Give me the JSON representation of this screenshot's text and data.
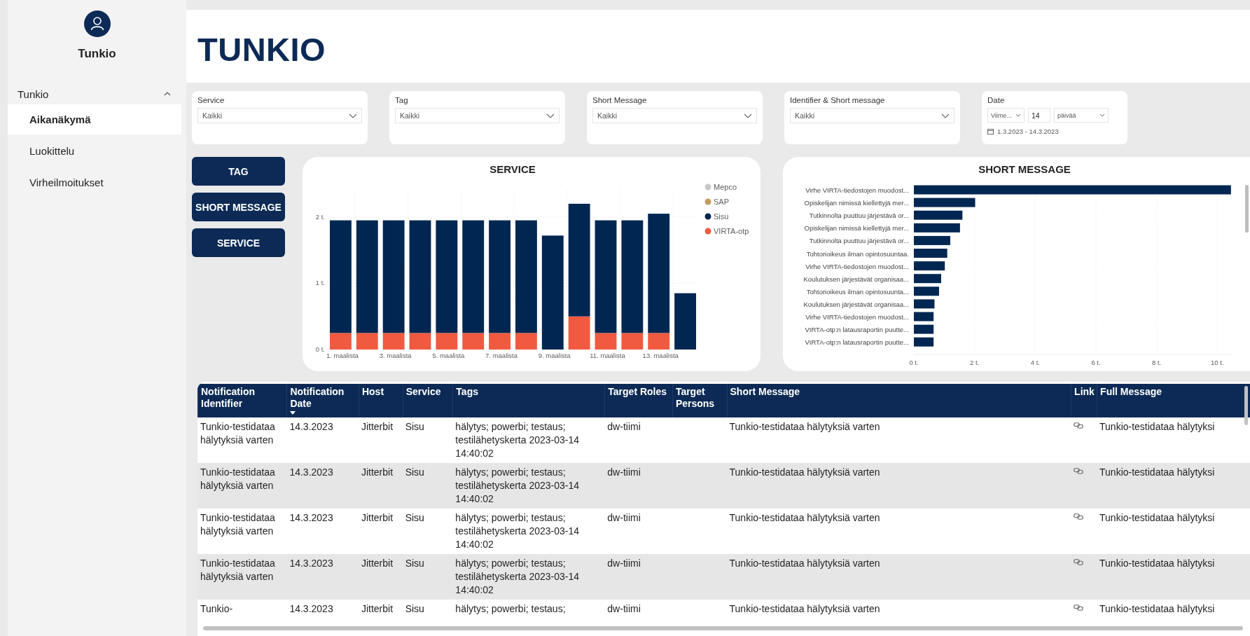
{
  "sidebar": {
    "user_name": "Tunkio",
    "groups": [
      {
        "label": "Tunkio",
        "expanded": true,
        "children": [
          {
            "label": "Aikanäkymä",
            "selected": true
          },
          {
            "label": "Luokittelu",
            "selected": false
          },
          {
            "label": "Virheilmoitukset",
            "selected": false
          }
        ]
      }
    ]
  },
  "header": {
    "title": "TUNKIO"
  },
  "filters": [
    {
      "kind": "dropdown",
      "label": "Service",
      "value": "Kaikki"
    },
    {
      "kind": "dropdown",
      "label": "Tag",
      "value": "Kaikki"
    },
    {
      "kind": "dropdown",
      "label": "Short Message",
      "value": "Kaikki"
    },
    {
      "kind": "dropdown",
      "label": "Identifier & Short message",
      "value": "Kaikki"
    },
    {
      "kind": "relative_date",
      "label": "Date",
      "period": "Viime...",
      "amount": "14",
      "unit": "päivää",
      "range": "1.3.2023 - 14.3.2023"
    }
  ],
  "buttons": [
    "TAG",
    "SHORT MESSAGE",
    "SERVICE"
  ],
  "service_chart": {
    "chart_data": {
      "type": "bar",
      "title": "SERVICE",
      "stacked": true,
      "grid": true,
      "legend": true,
      "x": [
        1,
        2,
        3,
        4,
        5,
        6,
        7,
        8,
        9,
        10,
        11,
        12,
        13,
        14
      ],
      "xlim": [
        0.5,
        14.5
      ],
      "xticks": [
        {
          "value": 1,
          "label": "1. maalista"
        },
        {
          "value": 3,
          "label": "3. maalista"
        },
        {
          "value": 5,
          "label": "5. maalista"
        },
        {
          "value": 7,
          "label": "7. maalista"
        },
        {
          "value": 9,
          "label": "9. maalista"
        },
        {
          "value": 11,
          "label": "11. maalista"
        },
        {
          "value": 13,
          "label": "13. maalista"
        }
      ],
      "ylim": [
        0,
        2.4
      ],
      "yticks": [
        {
          "value": 0,
          "label": "0 t."
        },
        {
          "value": 1,
          "label": "1 t."
        },
        {
          "value": 2,
          "label": "2 t."
        }
      ],
      "series": [
        {
          "name": "Mepco",
          "color": "#c8c8c8",
          "values": [
            0,
            0,
            0,
            0,
            0,
            0,
            0,
            0,
            0,
            0,
            0,
            0,
            0,
            0
          ]
        },
        {
          "name": "SAP",
          "color": "#c29b5a",
          "values": [
            0,
            0,
            0,
            0,
            0,
            0,
            0,
            0,
            0,
            0,
            0,
            0,
            0,
            0
          ]
        },
        {
          "name": "Sisu",
          "color": "#002652",
          "values": [
            1.7,
            1.7,
            1.7,
            1.7,
            1.7,
            1.7,
            1.7,
            1.7,
            1.72,
            1.7,
            1.7,
            1.7,
            1.8,
            0.85
          ]
        },
        {
          "name": "VIRTA-otp",
          "color": "#f05a40",
          "values": [
            0.25,
            0.25,
            0.25,
            0.25,
            0.25,
            0.25,
            0.25,
            0.25,
            0,
            0.5,
            0.25,
            0.25,
            0.25,
            0
          ]
        }
      ]
    }
  },
  "short_message_chart": {
    "chart_data": {
      "type": "bar",
      "title": "SHORT MESSAGE",
      "orientation": "horizontal",
      "grid": true,
      "categories": [
        "Virhe VIRTA-tiedostojen muodost...",
        "Opiskelijan nimissä kiellettyjä mer...",
        "Tutkinnolta puuttuu järjestävä or...",
        "Opiskelijan nimissä kiellettyjä mer...",
        "Tutkinnolta puuttuu järjestävä or...",
        "Tohtorioikeus ilman opintosuuntaa.",
        "Virhe VIRTA-tiedostojen muodost...",
        "Koulutuksen järjestävät organisaa...",
        "Tohtorioikeus ilman opintosuunta...",
        "Koulutuksen järjestävät organisaa...",
        "Virhe VIRTA-tiedostojen muodost...",
        "VIRTA-otp:n latausraportin puutte...",
        "VIRTA-otp:n latausraportin puutte..."
      ],
      "values": [
        10.45,
        2.02,
        1.6,
        1.52,
        1.2,
        1.1,
        1.02,
        0.9,
        0.83,
        0.68,
        0.65,
        0.65,
        0.65
      ],
      "xlim": [
        0,
        10.5
      ],
      "xticks": [
        {
          "value": 0,
          "label": "0 t."
        },
        {
          "value": 2,
          "label": "2 t."
        },
        {
          "value": 4,
          "label": "4 t."
        },
        {
          "value": 6,
          "label": "6 t."
        },
        {
          "value": 8,
          "label": "8 t."
        },
        {
          "value": 10,
          "label": "10 t."
        }
      ]
    }
  },
  "table": {
    "columns": [
      {
        "label": "Notification Identifier",
        "sorted": false
      },
      {
        "label": "Notification Date",
        "sorted": true
      },
      {
        "label": "Host",
        "sorted": false
      },
      {
        "label": "Service",
        "sorted": false
      },
      {
        "label": "Tags",
        "sorted": false
      },
      {
        "label": "Target Roles",
        "sorted": false
      },
      {
        "label": "Target Persons",
        "sorted": false
      },
      {
        "label": "Short Message",
        "sorted": false
      },
      {
        "label": "Link",
        "sorted": false
      },
      {
        "label": "Full Message",
        "sorted": false
      }
    ],
    "rows": [
      {
        "identifier": "Tunkio-testidataa hälytyksiä varten",
        "date": "14.3.2023",
        "host": "Jitterbit",
        "service": "Sisu",
        "tags": "hälytys; powerbi; testaus; testilähetyskerta 2023-03-14 14:40:02",
        "target_roles": "dw-tiimi",
        "short_message": "Tunkio-testidataa hälytyksiä varten",
        "has_link": true,
        "full_message": "Tunkio-testidataa hälytyksi"
      },
      {
        "identifier": "Tunkio-testidataa hälytyksiä varten",
        "date": "14.3.2023",
        "host": "Jitterbit",
        "service": "Sisu",
        "tags": "hälytys; powerbi; testaus; testilähetyskerta 2023-03-14 14:40:02",
        "target_roles": "dw-tiimi",
        "short_message": "Tunkio-testidataa hälytyksiä varten",
        "has_link": true,
        "full_message": "Tunkio-testidataa hälytyksi"
      },
      {
        "identifier": "Tunkio-testidataa hälytyksiä varten",
        "date": "14.3.2023",
        "host": "Jitterbit",
        "service": "Sisu",
        "tags": "hälytys; powerbi; testaus; testilähetyskerta 2023-03-14 14:40:02",
        "target_roles": "dw-tiimi",
        "short_message": "Tunkio-testidataa hälytyksiä varten",
        "has_link": true,
        "full_message": "Tunkio-testidataa hälytyksi"
      },
      {
        "identifier": "Tunkio-testidataa hälytyksiä varten",
        "date": "14.3.2023",
        "host": "Jitterbit",
        "service": "Sisu",
        "tags": "hälytys; powerbi; testaus; testilähetyskerta 2023-03-14 14:40:02",
        "target_roles": "dw-tiimi",
        "short_message": "Tunkio-testidataa hälytyksiä varten",
        "has_link": true,
        "full_message": "Tunkio-testidataa hälytyksi"
      },
      {
        "identifier": "Tunkio-",
        "date": "14.3.2023",
        "host": "Jitterbit",
        "service": "Sisu",
        "tags": "hälytys; powerbi; testaus;",
        "target_roles": "dw-tiimi",
        "short_message": "Tunkio-testidataa hälytyksiä varten",
        "has_link": true,
        "full_message": "Tunkio-testidataa hälytyksi"
      }
    ]
  }
}
